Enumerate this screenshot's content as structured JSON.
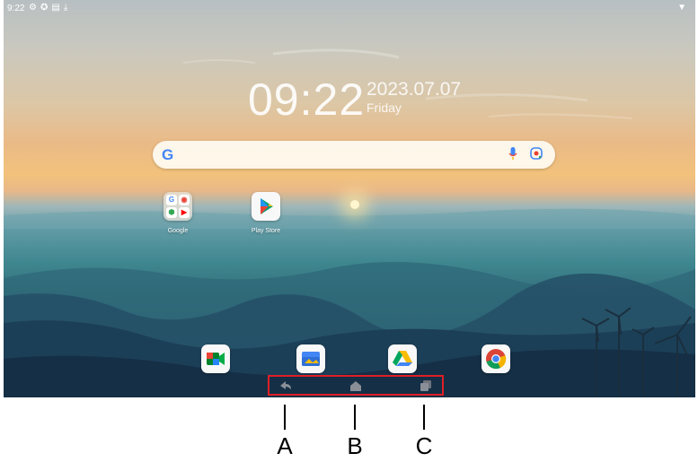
{
  "status_bar": {
    "time": "9:22",
    "icons": [
      "gear-icon",
      "gear-icon",
      "sim-icon",
      "download-icon"
    ],
    "wifi_icon": "wifi-icon"
  },
  "clock": {
    "time": "09:22",
    "date": "2023.07.07",
    "day": "Friday"
  },
  "search": {
    "logo": "G",
    "icons": [
      "mic-icon",
      "lens-icon"
    ]
  },
  "apps": [
    {
      "label": "Google",
      "icon": "google-folder-icon"
    },
    {
      "label": "Play Store",
      "icon": "play-store-icon"
    }
  ],
  "dock": [
    {
      "icon": "meet-icon"
    },
    {
      "icon": "files-icon"
    },
    {
      "icon": "drive-icon"
    },
    {
      "icon": "chrome-icon"
    }
  ],
  "nav": {
    "back_icon": "back-icon",
    "home_icon": "home-icon",
    "recents_icon": "recents-icon",
    "highlight_color": "#e01f26"
  },
  "markers": {
    "a": "A",
    "b": "B",
    "c": "C"
  }
}
